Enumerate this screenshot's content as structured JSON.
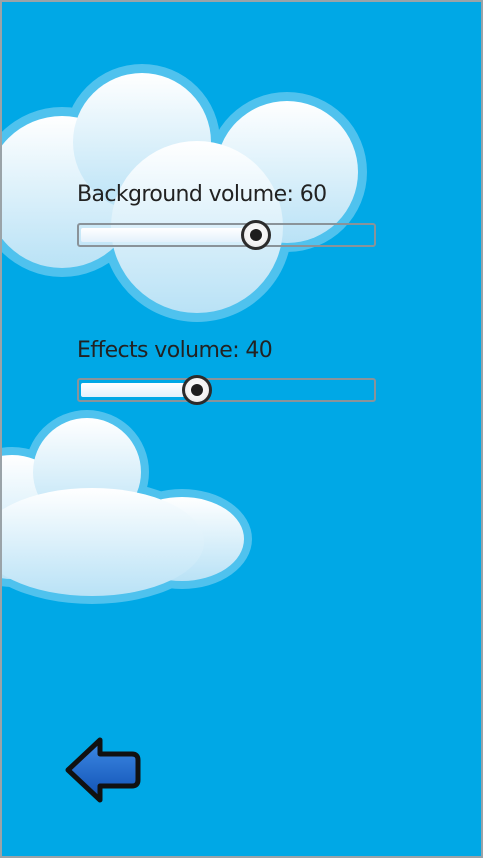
{
  "settings": {
    "background_volume": {
      "label": "Background volume: 60",
      "value": 60,
      "max": 100
    },
    "effects_volume": {
      "label": "Effects volume: 40",
      "value": 40,
      "max": 100
    }
  },
  "navigation": {
    "back_icon": "left-arrow-icon"
  },
  "colors": {
    "sky": "#00a8e6",
    "cloud": "#dff1fb",
    "arrow": "#1560c8"
  }
}
